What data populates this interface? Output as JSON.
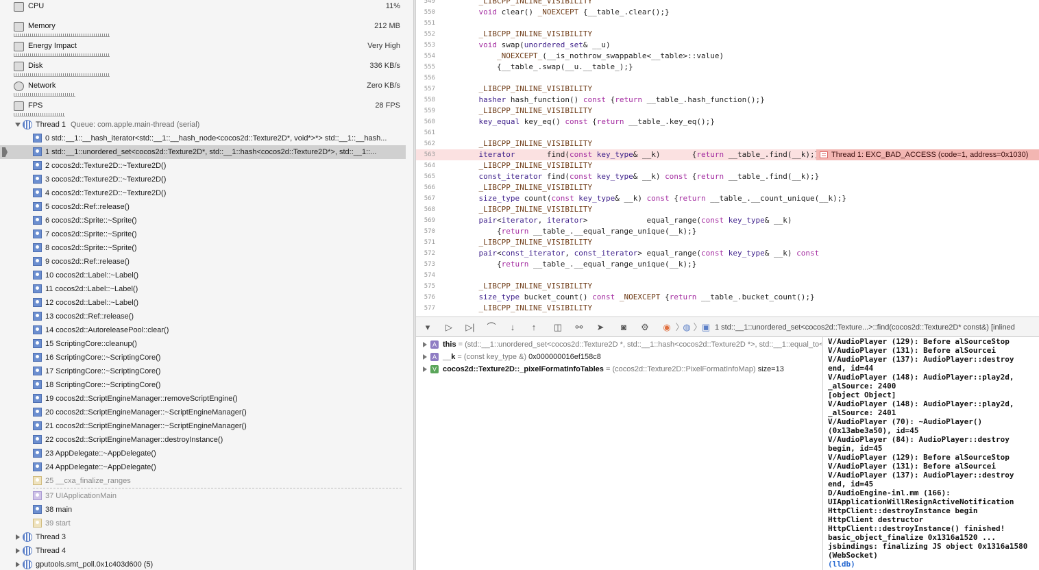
{
  "gauges": [
    {
      "label": "CPU",
      "value": "11%",
      "icon": "cpu-icon"
    },
    {
      "label": "Memory",
      "value": "212 MB",
      "icon": "memory-icon"
    },
    {
      "label": "Energy Impact",
      "value": "Very High",
      "icon": "energy-icon"
    },
    {
      "label": "Disk",
      "value": "336 KB/s",
      "icon": "disk-icon"
    },
    {
      "label": "Network",
      "value": "Zero KB/s",
      "icon": "network-icon"
    },
    {
      "label": "FPS",
      "value": "28 FPS",
      "icon": "fps-icon"
    }
  ],
  "thread1": {
    "label": "Thread 1",
    "queue": "Queue: com.apple.main-thread (serial)"
  },
  "frames": [
    "0 std::__1::__hash_iterator<std::__1::__hash_node<cocos2d::Texture2D*, void*>*> std::__1::__hash...",
    "1 std::__1::unordered_set<cocos2d::Texture2D*, std::__1::hash<cocos2d::Texture2D*>, std::__1::...",
    "2 cocos2d::Texture2D::~Texture2D()",
    "3 cocos2d::Texture2D::~Texture2D()",
    "4 cocos2d::Texture2D::~Texture2D()",
    "5 cocos2d::Ref::release()",
    "6 cocos2d::Sprite::~Sprite()",
    "7 cocos2d::Sprite::~Sprite()",
    "8 cocos2d::Sprite::~Sprite()",
    "9 cocos2d::Ref::release()",
    "10 cocos2d::Label::~Label()",
    "11 cocos2d::Label::~Label()",
    "12 cocos2d::Label::~Label()",
    "13 cocos2d::Ref::release()",
    "14 cocos2d::AutoreleasePool::clear()",
    "15 ScriptingCore::cleanup()",
    "16 ScriptingCore::~ScriptingCore()",
    "17 ScriptingCore::~ScriptingCore()",
    "18 ScriptingCore::~ScriptingCore()",
    "19 cocos2d::ScriptEngineManager::removeScriptEngine()",
    "20 cocos2d::ScriptEngineManager::~ScriptEngineManager()",
    "21 cocos2d::ScriptEngineManager::~ScriptEngineManager()",
    "22 cocos2d::ScriptEngineManager::destroyInstance()",
    "23 AppDelegate::~AppDelegate()",
    "24 AppDelegate::~AppDelegate()",
    "25 __cxa_finalize_ranges"
  ],
  "frames_tail": [
    "37 UIApplicationMain",
    "38 main",
    "39 start"
  ],
  "other_threads": [
    "Thread 3",
    "Thread 4",
    "gputools.smt_poll.0x1c403d600 (5)"
  ],
  "code_lines": [
    {
      "n": "549",
      "t": "    _LIBCPP_INLINE_VISIBILITY"
    },
    {
      "n": "550",
      "t": "    void clear() _NOEXCEPT {__table_.clear();}"
    },
    {
      "n": "551",
      "t": ""
    },
    {
      "n": "552",
      "t": "    _LIBCPP_INLINE_VISIBILITY"
    },
    {
      "n": "553",
      "t": "    void swap(unordered_set& __u)"
    },
    {
      "n": "554",
      "t": "        _NOEXCEPT_(__is_nothrow_swappable<__table>::value)"
    },
    {
      "n": "555",
      "t": "        {__table_.swap(__u.__table_);}"
    },
    {
      "n": "556",
      "t": ""
    },
    {
      "n": "557",
      "t": "    _LIBCPP_INLINE_VISIBILITY"
    },
    {
      "n": "558",
      "t": "    hasher hash_function() const {return __table_.hash_function();}"
    },
    {
      "n": "559",
      "t": "    _LIBCPP_INLINE_VISIBILITY"
    },
    {
      "n": "560",
      "t": "    key_equal key_eq() const {return __table_.key_eq();}"
    },
    {
      "n": "561",
      "t": ""
    },
    {
      "n": "562",
      "t": "    _LIBCPP_INLINE_VISIBILITY"
    },
    {
      "n": "563",
      "t": "    iterator       find(const key_type& __k)       {return __table_.find(__k);}"
    },
    {
      "n": "564",
      "t": "    _LIBCPP_INLINE_VISIBILITY"
    },
    {
      "n": "565",
      "t": "    const_iterator find(const key_type& __k) const {return __table_.find(__k);}"
    },
    {
      "n": "566",
      "t": "    _LIBCPP_INLINE_VISIBILITY"
    },
    {
      "n": "567",
      "t": "    size_type count(const key_type& __k) const {return __table_.__count_unique(__k);}"
    },
    {
      "n": "568",
      "t": "    _LIBCPP_INLINE_VISIBILITY"
    },
    {
      "n": "569",
      "t": "    pair<iterator, iterator>             equal_range(const key_type& __k)"
    },
    {
      "n": "570",
      "t": "        {return __table_.__equal_range_unique(__k);}"
    },
    {
      "n": "571",
      "t": "    _LIBCPP_INLINE_VISIBILITY"
    },
    {
      "n": "572",
      "t": "    pair<const_iterator, const_iterator> equal_range(const key_type& __k) const"
    },
    {
      "n": "573",
      "t": "        {return __table_.__equal_range_unique(__k);}"
    },
    {
      "n": "574",
      "t": ""
    },
    {
      "n": "575",
      "t": "    _LIBCPP_INLINE_VISIBILITY"
    },
    {
      "n": "576",
      "t": "    size_type bucket_count() const _NOEXCEPT {return __table_.bucket_count();}"
    },
    {
      "n": "577",
      "t": "    _LIBCPP_INLINE_VISIBILITY"
    }
  ],
  "error_line": "563",
  "error_message": "Thread 1: EXC_BAD_ACCESS (code=1, address=0x1030)",
  "debug_breadcrumb": "1 std::__1::unordered_set<cocos2d::Texture...>::find(cocos2d::Texture2D* const&) [inlined",
  "variables": [
    {
      "badge": "A",
      "name": "this",
      "type": "(std::__1::unordered_set<cocos2d::Texture2D *, std::__1::hash<cocos2d::Texture2D *>, std::__1::equal_to<co...",
      "value": ""
    },
    {
      "badge": "A",
      "name": "__k",
      "type": "(const key_type &)",
      "value": "0x000000016ef158c8"
    },
    {
      "badge": "V",
      "name": "cocos2d::Texture2D::_pixelFormatInfoTables",
      "type": "(cocos2d::Texture2D::PixelFormatInfoMap)",
      "value": "size=13"
    }
  ],
  "console_lines": [
    "V/AudioPlayer (129): Before alSourceStop",
    "V/AudioPlayer (131): Before alSourcei",
    "V/AudioPlayer (137): AudioPlayer::destroy",
    "end, id=44",
    "V/AudioPlayer (148): AudioPlayer::play2d,",
    "_alSource: 2400",
    "[object Object]",
    "V/AudioPlayer (148): AudioPlayer::play2d,",
    "_alSource: 2401",
    "V/AudioPlayer (70): ~AudioPlayer()",
    "(0x13abe3a50), id=45",
    "V/AudioPlayer (84): AudioPlayer::destroy",
    "begin, id=45",
    "V/AudioPlayer (129): Before alSourceStop",
    "V/AudioPlayer (131): Before alSourcei",
    "V/AudioPlayer (137): AudioPlayer::destroy",
    "end, id=45",
    "D/AudioEngine-inl.mm (166):",
    "UIApplicationWillResignActiveNotification",
    "HttpClient::destroyInstance begin",
    "HttpClient destructor",
    "HttpClient::destroyInstance() finished!",
    "basic_object_finalize 0x1316a1520 ...",
    "jsbindings: finalizing JS object 0x1316a1580",
    "(WebSocket)"
  ],
  "console_prompt": "(lldb)",
  "toolbar_icons": [
    "filter-icon",
    "breakpoint-toggle-icon",
    "continue-icon",
    "step-over-icon",
    "step-into-icon",
    "step-out-icon",
    "view-hierarchy-icon",
    "memory-graph-icon",
    "simulate-location-icon",
    "camera-icon",
    "settings-icon"
  ],
  "colors": {
    "error_bg": "#fbe1e1",
    "error_badge": "#f3b6b2",
    "selected_frame": "#d0d0d0",
    "keyword": "#a32ba0",
    "lldb_prompt": "#2a6bd1"
  }
}
